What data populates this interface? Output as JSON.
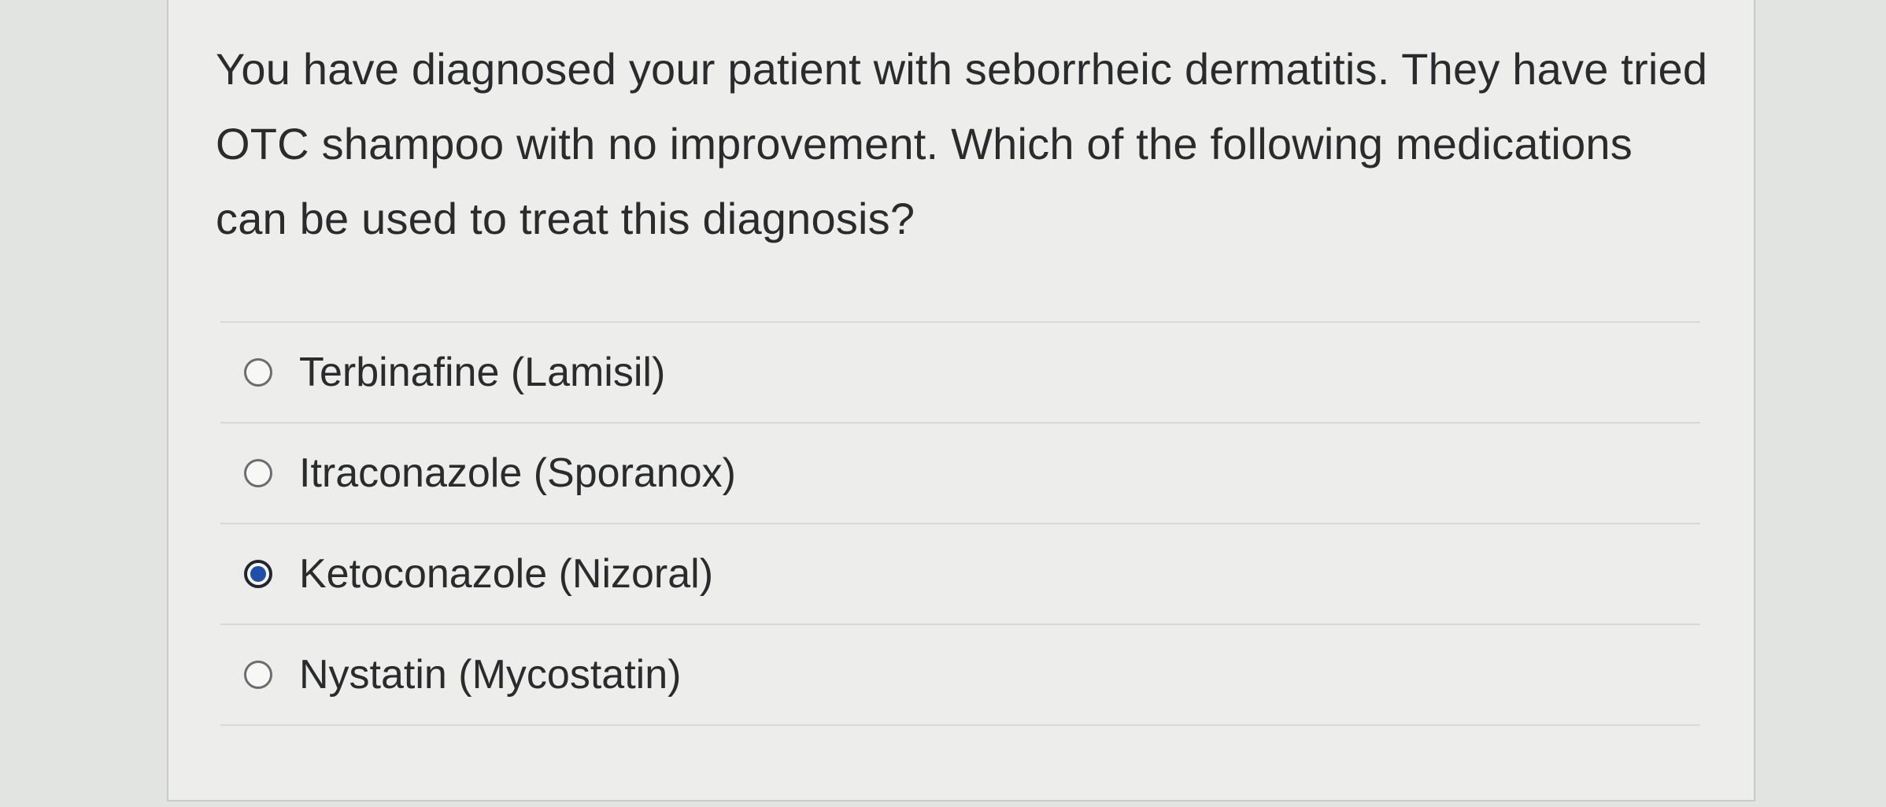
{
  "question": {
    "text": "You have diagnosed your patient with seborrheic dermatitis. They have tried OTC shampoo with no improvement. Which of the following medications can be used to treat this diagnosis?"
  },
  "options": [
    {
      "label": "Terbinafine (Lamisil)",
      "selected": false
    },
    {
      "label": "Itraconazole (Sporanox)",
      "selected": false
    },
    {
      "label": "Ketoconazole (Nizoral)",
      "selected": true
    },
    {
      "label": "Nystatin (Mycostatin)",
      "selected": false
    }
  ],
  "colors": {
    "selected_dot": "#1f4fa8",
    "card_background": "#ededeb"
  }
}
